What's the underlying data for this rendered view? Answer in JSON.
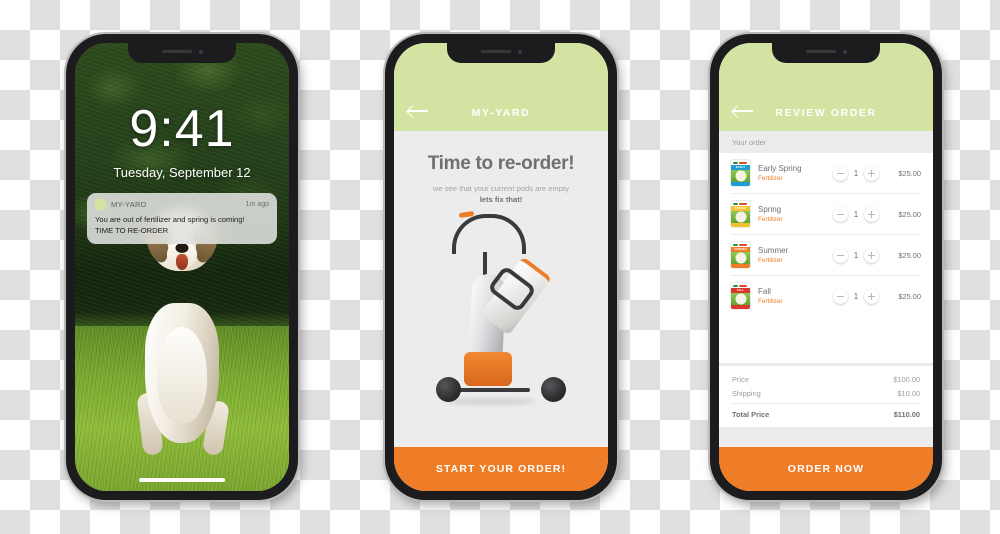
{
  "phone1": {
    "name": "lock-screen",
    "time": "9:41",
    "date": "Tuesday, September 12",
    "notification": {
      "app": "MY-YARD",
      "time_ago": "1m ago",
      "line1": "You are out of fertilizer and spring is coming!",
      "line2": "TIME TO RE-ORDER"
    }
  },
  "phone2": {
    "name": "reorder-screen",
    "header": {
      "title": "MY-YARD",
      "back_icon": "back-arrow-icon"
    },
    "heading": "Time to re-order!",
    "sub1": "we see that your current pods are empty",
    "sub2": "lets fix that!",
    "illustration": "lawn-spreader-illustration",
    "cta": "START YOUR ORDER!"
  },
  "phone3": {
    "name": "review-order-screen",
    "header": {
      "title": "REVIEW ORDER",
      "back_icon": "back-arrow-icon"
    },
    "section_label": "Your order",
    "items": [
      {
        "name": "Early Spring",
        "type": "Fertilizer",
        "qty": "1",
        "price": "$25.00",
        "bag_color": "#1d9fd4",
        "bag_label": "EARLY SPRING"
      },
      {
        "name": "Spring",
        "type": "Fertilizer",
        "qty": "1",
        "price": "$25.00",
        "bag_color": "#f2c230",
        "bag_label": "SPRING"
      },
      {
        "name": "Summer",
        "type": "Fertilizer",
        "qty": "1",
        "price": "$25.00",
        "bag_color": "#ef7c26",
        "bag_label": "SUMMER"
      },
      {
        "name": "Fall",
        "type": "Fertilizer",
        "qty": "1",
        "price": "$25.00",
        "bag_color": "#d8382c",
        "bag_label": "FALL"
      }
    ],
    "totals": {
      "price_label": "Price",
      "price_value": "$100.00",
      "shipping_label": "Shipping",
      "shipping_value": "$10.00",
      "total_label": "Total Price",
      "total_value": "$110.00"
    },
    "cta": "ORDER NOW"
  },
  "colors": {
    "green": "#d3e3a2",
    "orange": "#ef7c26",
    "grey_text": "#6f7072",
    "light_grey_bg": "#ececec"
  }
}
